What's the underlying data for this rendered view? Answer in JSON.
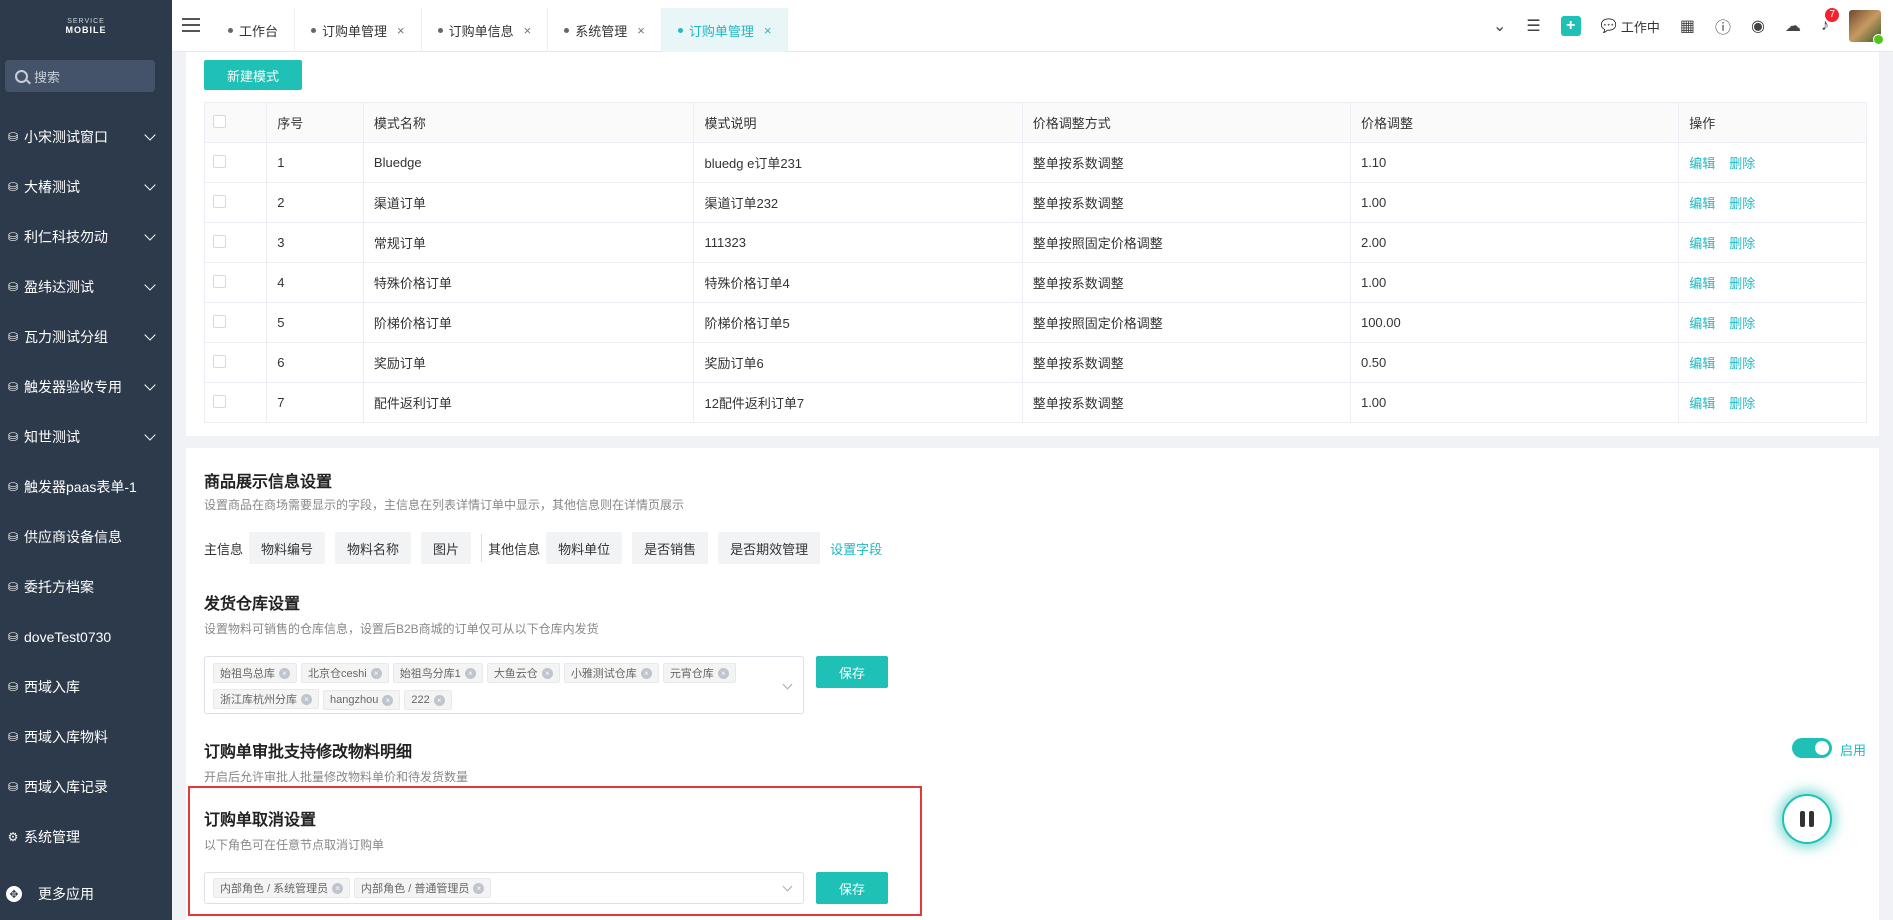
{
  "logo": {
    "line1": "SERVICE",
    "line2": "MOBILE"
  },
  "search": {
    "placeholder": "搜索"
  },
  "sidebar": {
    "items": [
      {
        "label": "小宋测试窗口",
        "expandable": true
      },
      {
        "label": "大椿测试",
        "expandable": true
      },
      {
        "label": "利仁科技勿动",
        "expandable": true
      },
      {
        "label": "盈纬达测试",
        "expandable": true
      },
      {
        "label": "瓦力测试分组",
        "expandable": true
      },
      {
        "label": "触发器验收专用",
        "expandable": true
      },
      {
        "label": "知世测试",
        "expandable": true
      },
      {
        "label": "触发器paas表单-1",
        "expandable": false
      },
      {
        "label": "供应商设备信息",
        "expandable": false
      },
      {
        "label": "委托方档案",
        "expandable": false
      },
      {
        "label": "doveTest0730",
        "expandable": false
      },
      {
        "label": "西域入库",
        "expandable": false
      },
      {
        "label": "西域入库物料",
        "expandable": false
      },
      {
        "label": "西域入库记录",
        "expandable": false
      },
      {
        "label": "系统管理",
        "expandable": false
      }
    ],
    "more": "更多应用"
  },
  "tabs": [
    {
      "label": "工作台",
      "closable": false,
      "active": false
    },
    {
      "label": "订购单管理",
      "closable": true,
      "active": false
    },
    {
      "label": "订购单信息",
      "closable": true,
      "active": false
    },
    {
      "label": "系统管理",
      "closable": true,
      "active": false
    },
    {
      "label": "订购单管理",
      "closable": true,
      "active": true
    }
  ],
  "topbar": {
    "working": "工作中",
    "notif_count": "7",
    "close_glyph": "×"
  },
  "mode_section": {
    "new_button": "新建模式",
    "columns": [
      "序号",
      "模式名称",
      "模式说明",
      "价格调整方式",
      "价格调整",
      "操作"
    ],
    "rows": [
      [
        "1",
        "Bluedge",
        "bluedg e订单231",
        "整单按系数调整",
        "1.10"
      ],
      [
        "2",
        "渠道订单",
        "渠道订单232",
        "整单按系数调整",
        "1.00"
      ],
      [
        "3",
        "常规订单",
        "111323",
        "整单按照固定价格调整",
        "2.00"
      ],
      [
        "4",
        "特殊价格订单",
        "特殊价格订单4",
        "整单按系数调整",
        "1.00"
      ],
      [
        "5",
        "阶梯价格订单",
        "阶梯价格订单5",
        "整单按照固定价格调整",
        "100.00"
      ],
      [
        "6",
        "奖励订单",
        "奖励订单6",
        "整单按系数调整",
        "0.50"
      ],
      [
        "7",
        "配件返利订单",
        "12配件返利订单7",
        "整单按系数调整",
        "1.00"
      ]
    ],
    "edit": "编辑",
    "delete": "删除"
  },
  "product_display": {
    "title": "商品展示信息设置",
    "desc": "设置商品在商场需要显示的字段，主信息在列表详情订单中显示，其他信息则在详情页展示",
    "main_label": "主信息",
    "main_fields": [
      "物料编号",
      "物料名称",
      "图片"
    ],
    "other_label": "其他信息",
    "other_fields": [
      "物料单位",
      "是否销售",
      "是否期效管理"
    ],
    "set_fields": "设置字段"
  },
  "warehouse": {
    "title": "发货仓库设置",
    "desc": "设置物料可销售的仓库信息，设置后B2B商城的订单仅可从以下仓库内发货",
    "tags": [
      "始祖鸟总库",
      "北京仓ceshi",
      "始祖鸟分库1",
      "大鱼云仓",
      "小雅测试仓库",
      "元宵仓库",
      "浙江库杭州分库",
      "hangzhou",
      "222"
    ],
    "save": "保存"
  },
  "approval": {
    "title": "订购单审批支持修改物料明细",
    "desc": "开启后允许审批人批量修改物料单价和待发货数量",
    "switch_label": "启用",
    "enabled": true
  },
  "cancel": {
    "title": "订购单取消设置",
    "desc": "以下角色可在任意节点取消订购单",
    "tags": [
      "内部角色 / 系统管理员",
      "内部角色 / 普通管理员"
    ],
    "save": "保存"
  }
}
